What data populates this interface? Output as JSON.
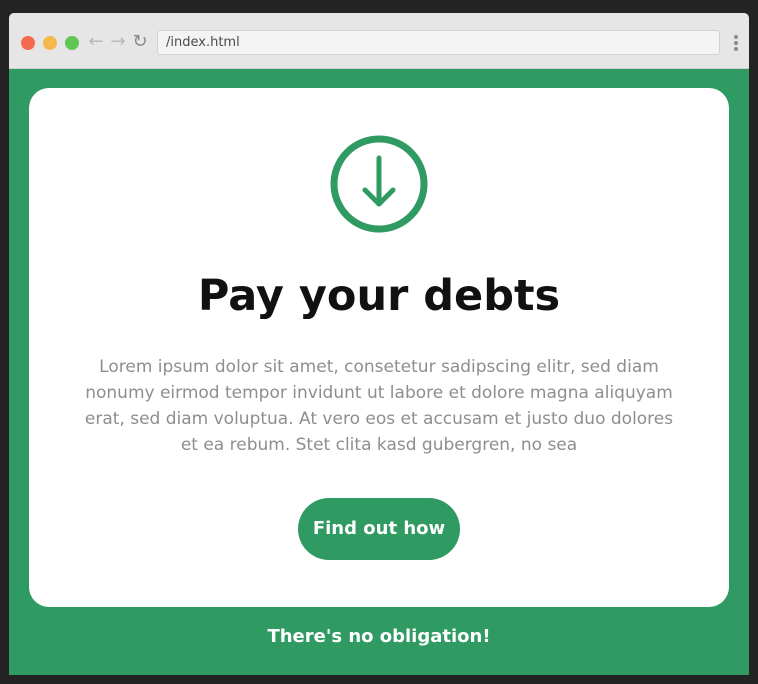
{
  "browser": {
    "address": "/index.html",
    "icons": {
      "back": "arrow-left-icon",
      "forward": "arrow-right-icon",
      "reload": "reload-icon",
      "menu": "vertical-dots-icon"
    }
  },
  "card": {
    "icon": "download-arrow-icon",
    "headline": "Pay your debts",
    "body": "Lorem ipsum dolor sit amet, consetetur sadipscing elitr, sed diam nonumy eirmod tempor invidunt ut labore et dolore magna aliquyam erat, sed diam voluptua. At vero eos et accusam et justo duo dolores et ea rebum. Stet clita kasd gubergren, no sea",
    "cta_label": "Find out how"
  },
  "footer": {
    "note": "There's no obligation!"
  },
  "colors": {
    "accent": "#2f9a62",
    "background": "#2f9a62",
    "card": "#ffffff",
    "headline": "#111111",
    "body_text": "#8e8e8e"
  }
}
